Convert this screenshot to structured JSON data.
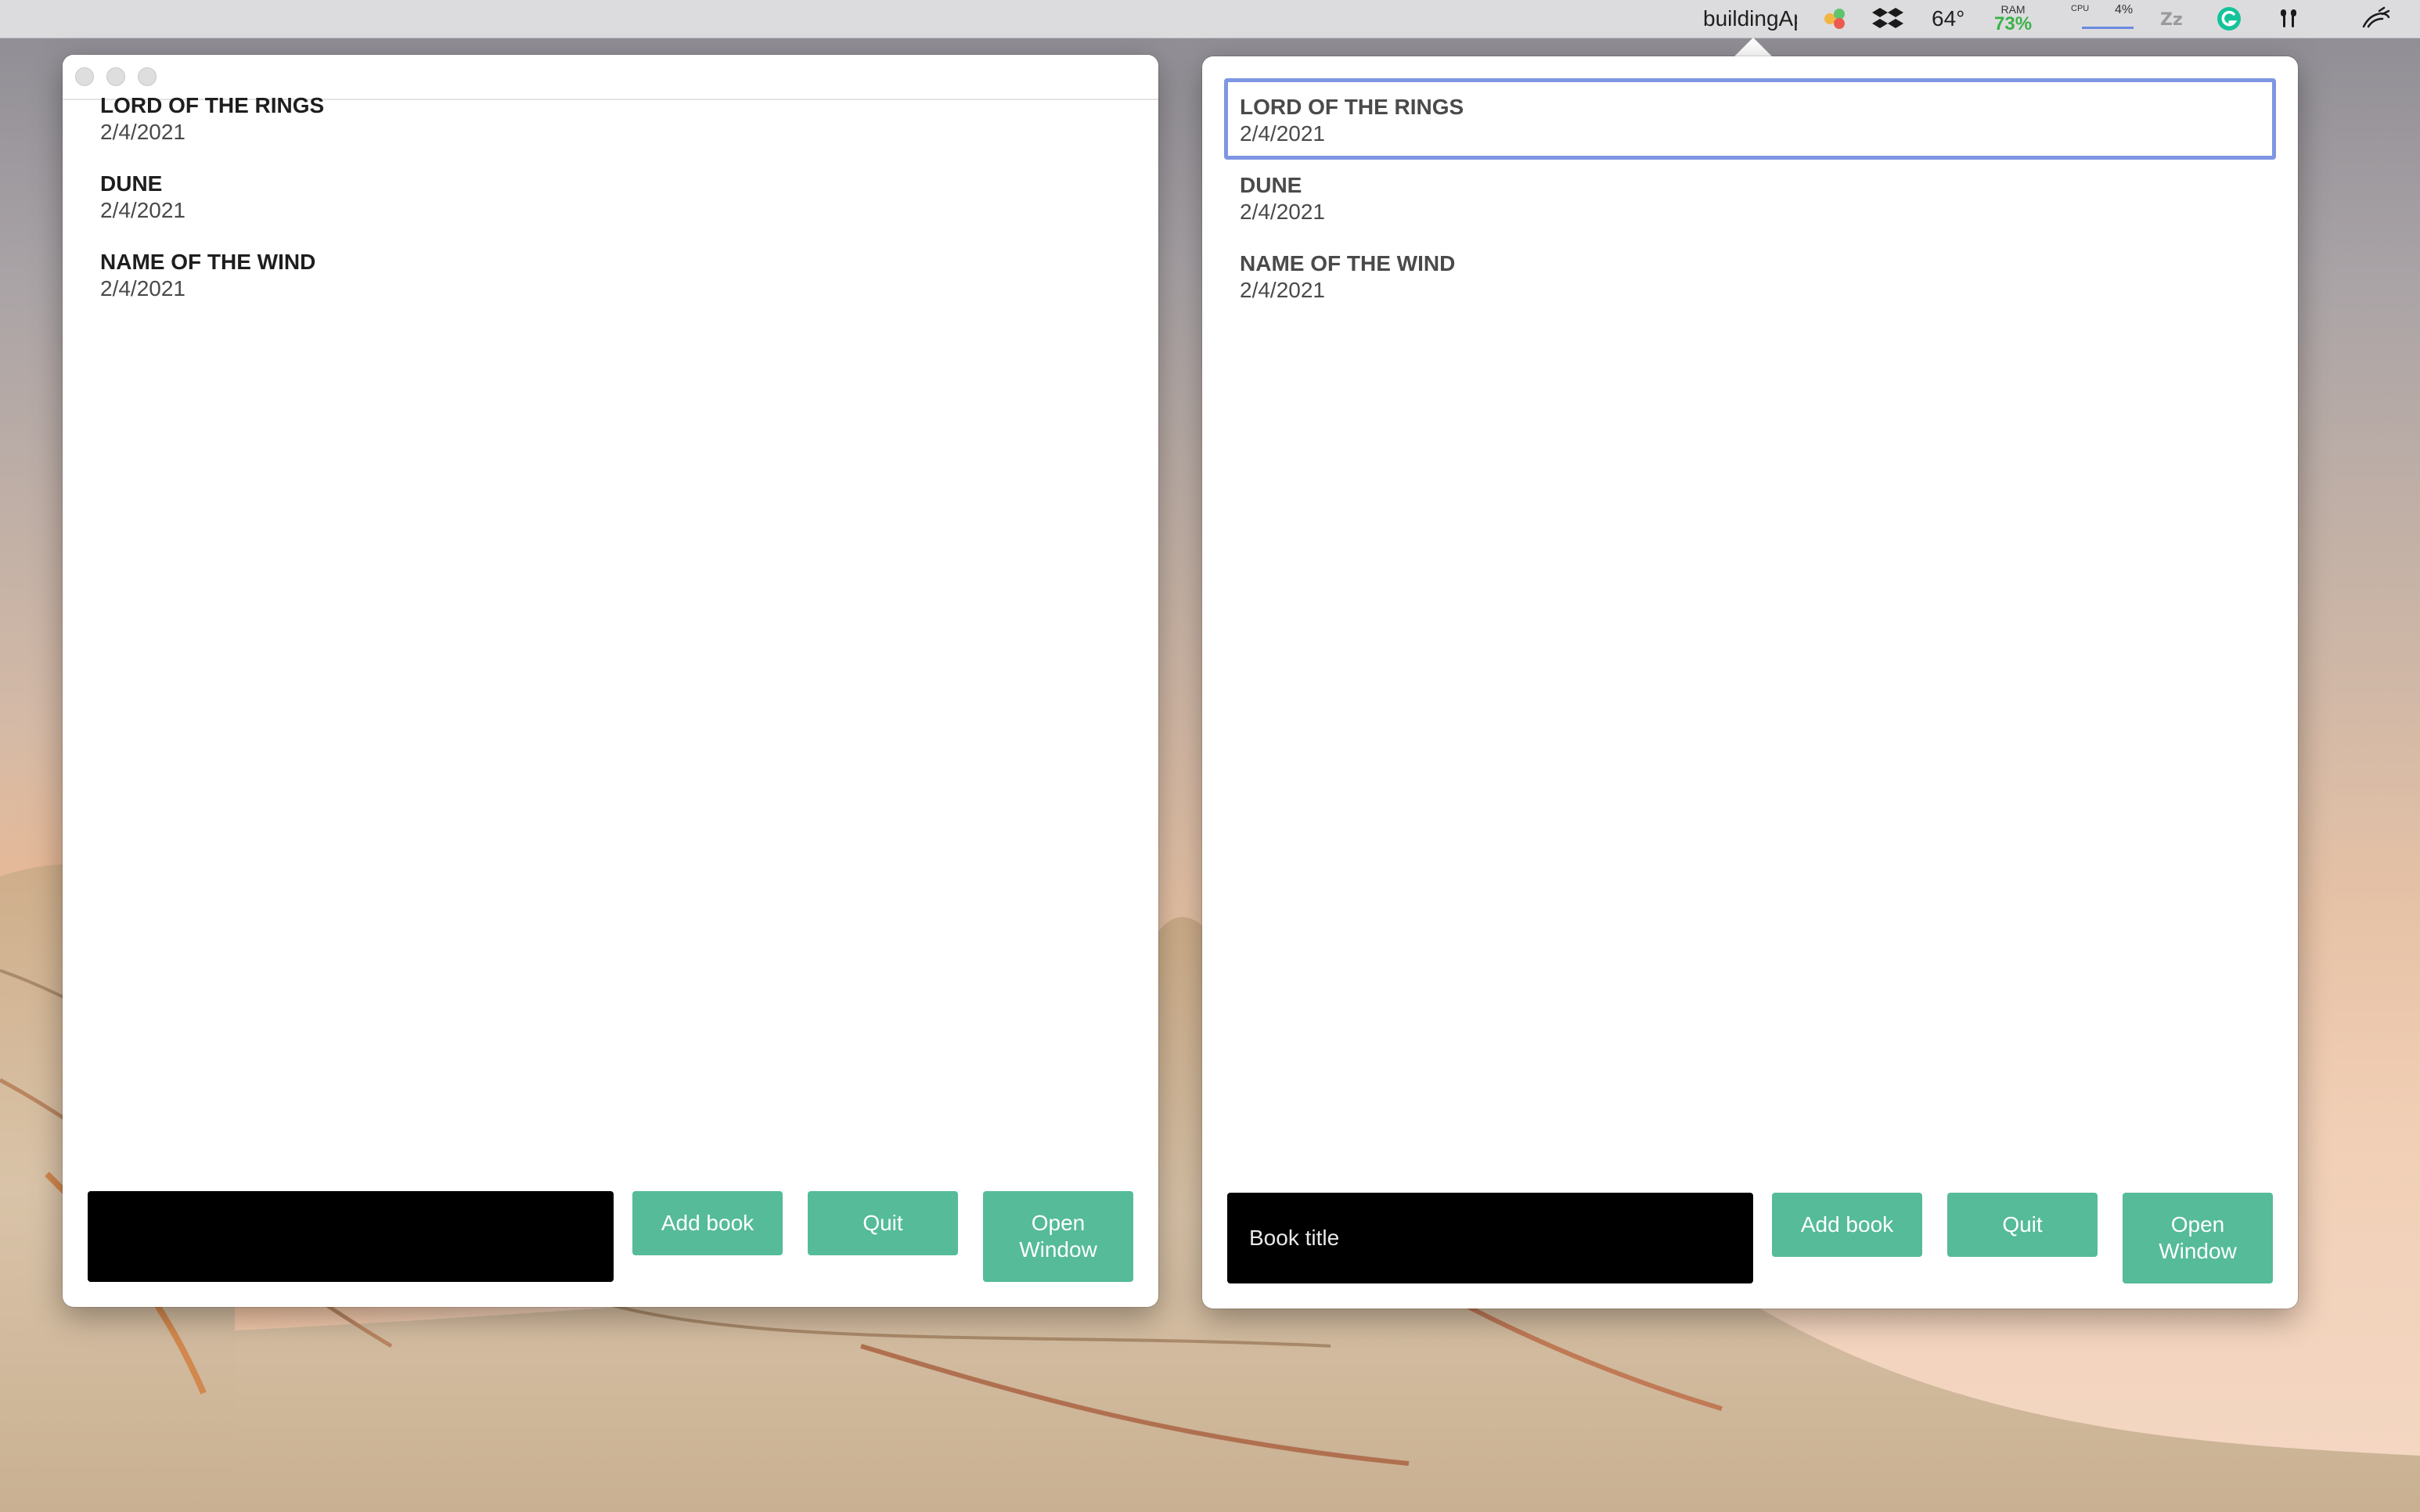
{
  "menubar": {
    "app_name": "buildingAp",
    "temperature": "64°",
    "ram_label": "RAM",
    "ram_value": "73%",
    "cpu_label": "CPU",
    "cpu_value": "4%",
    "colors": {
      "ram": "#3bb24a",
      "cpu_bar": "#6b8be0",
      "grammarly": "#15c39a"
    },
    "icons": [
      "color-dots-icon",
      "dropbox-icon",
      "sleep-zz-icon",
      "grammarly-icon",
      "airpods-icon",
      "notification-hand-icon"
    ]
  },
  "left_window": {
    "books": [
      {
        "title": "LORD OF THE RINGS",
        "date": "2/4/2021"
      },
      {
        "title": "DUNE",
        "date": "2/4/2021"
      },
      {
        "title": "NAME OF THE WIND",
        "date": "2/4/2021"
      }
    ],
    "input": {
      "value": "",
      "placeholder": ""
    },
    "buttons": {
      "add": "Add book",
      "quit": "Quit",
      "open_line1": "Open",
      "open_line2": "Window"
    }
  },
  "right_window": {
    "selected_index": 0,
    "books": [
      {
        "title": "LORD OF THE RINGS",
        "date": "2/4/2021"
      },
      {
        "title": "DUNE",
        "date": "2/4/2021"
      },
      {
        "title": "NAME OF THE WIND",
        "date": "2/4/2021"
      }
    ],
    "input": {
      "value": "",
      "placeholder": "Book title"
    },
    "buttons": {
      "add": "Add book",
      "quit": "Quit",
      "open_line1": "Open",
      "open_line2": "Window"
    }
  },
  "colors": {
    "accent_button": "#55bb99",
    "selection_border": "#7f96e2",
    "input_background": "#000000"
  }
}
